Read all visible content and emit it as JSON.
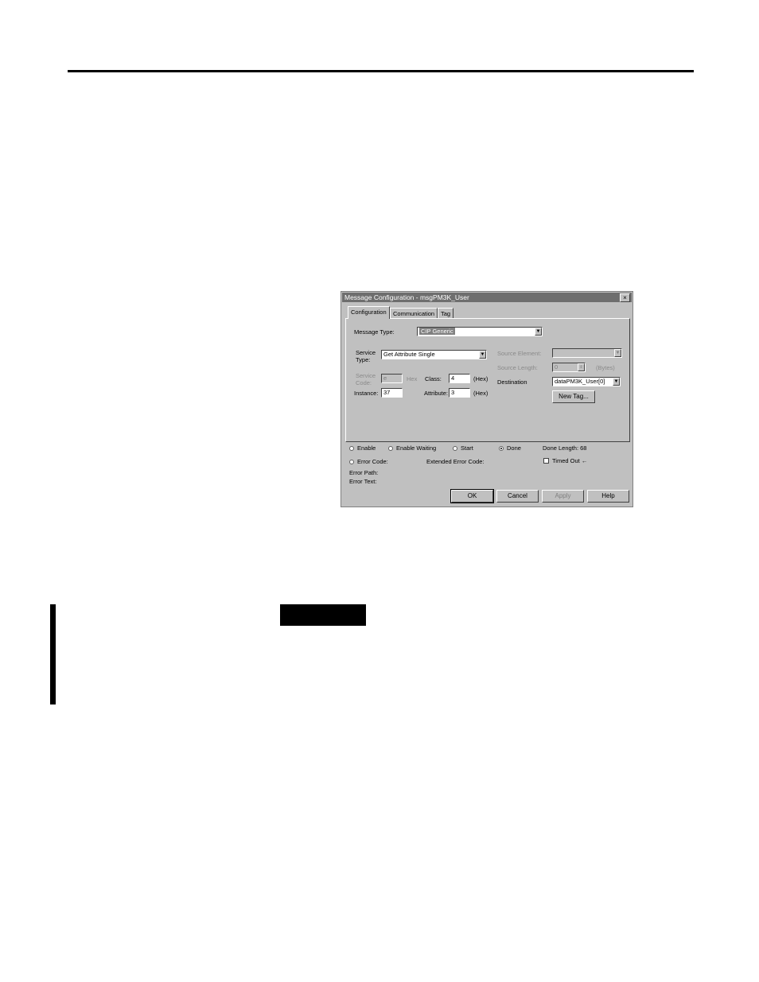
{
  "dialog": {
    "title": "Message Configuration - msgPM3K_User",
    "close": "×",
    "tabs": [
      {
        "label": "Configuration",
        "active": true
      },
      {
        "label": "Communication",
        "active": false
      },
      {
        "label": "Tag",
        "active": false
      }
    ],
    "message_type": {
      "label": "Message Type:",
      "value": "CIP Generic"
    },
    "service_type": {
      "label_line1": "Service",
      "label_line2": "Type:",
      "value": "Get Attribute Single"
    },
    "service_code": {
      "label_line1": "Service",
      "label_line2": "Code:",
      "value": "e",
      "unit": "Hex"
    },
    "class": {
      "label": "Class:",
      "value": "4",
      "unit": "(Hex)"
    },
    "instance": {
      "label": "Instance:",
      "value": "37"
    },
    "attribute": {
      "label": "Attribute:",
      "value": "3",
      "unit": "(Hex)"
    },
    "source_element": {
      "label": "Source Element:",
      "value": ""
    },
    "source_length": {
      "label": "Source Length:",
      "value": "0",
      "unit": "(Bytes)"
    },
    "destination": {
      "label": "Destination",
      "value": "dataPM3K_User[0]"
    },
    "new_tag_button": "New Tag...",
    "status": {
      "enable": "Enable",
      "enable_waiting": "Enable Waiting",
      "start": "Start",
      "done": "Done",
      "done_length": "Done Length: 68",
      "error_code": "Error Code:",
      "extended_error_code": "Extended Error Code:",
      "timed_out": "Timed Out ←",
      "error_path": "Error Path:",
      "error_text": "Error Text:"
    },
    "buttons": {
      "ok": "OK",
      "cancel": "Cancel",
      "apply": "Apply",
      "help": "Help"
    }
  }
}
